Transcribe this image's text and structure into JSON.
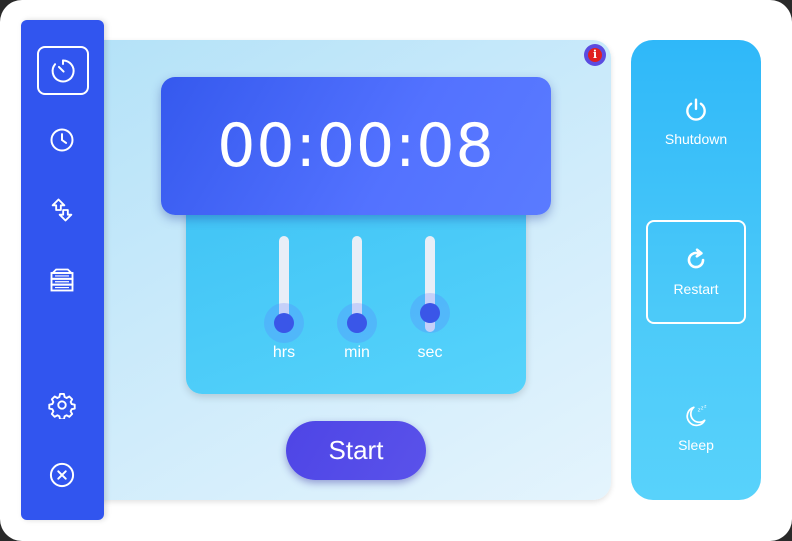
{
  "timer": {
    "display": "00:00:08",
    "sliders": [
      {
        "id": "hrs",
        "label": "hrs",
        "value_fraction": 0.0
      },
      {
        "id": "min",
        "label": "min",
        "value_fraction": 0.0
      },
      {
        "id": "sec",
        "label": "sec",
        "value_fraction": 0.13
      }
    ],
    "start_label": "Start"
  },
  "nav": {
    "items": [
      {
        "name": "timer",
        "icon": "timer-icon",
        "active": true
      },
      {
        "name": "clock",
        "icon": "clock-icon",
        "active": false
      },
      {
        "name": "transfer",
        "icon": "transfer-icon",
        "active": false
      },
      {
        "name": "storage",
        "icon": "storage-icon",
        "active": false
      },
      {
        "name": "settings",
        "icon": "gear-icon",
        "active": false
      },
      {
        "name": "close",
        "icon": "close-icon",
        "active": false
      }
    ]
  },
  "power": {
    "shutdown_label": "Shutdown",
    "restart_label": "Restart",
    "sleep_label": "Sleep",
    "selected": "restart"
  },
  "info_glyph": "i",
  "colors": {
    "nav_bg": "#3155ef",
    "time_card": "#4a68f7",
    "slider_card": "#4bcbf8",
    "power_panel": "#3ec0f9",
    "start_button": "#5249e8",
    "thumb": "#3a56e8",
    "info_badge": "#e02020"
  }
}
